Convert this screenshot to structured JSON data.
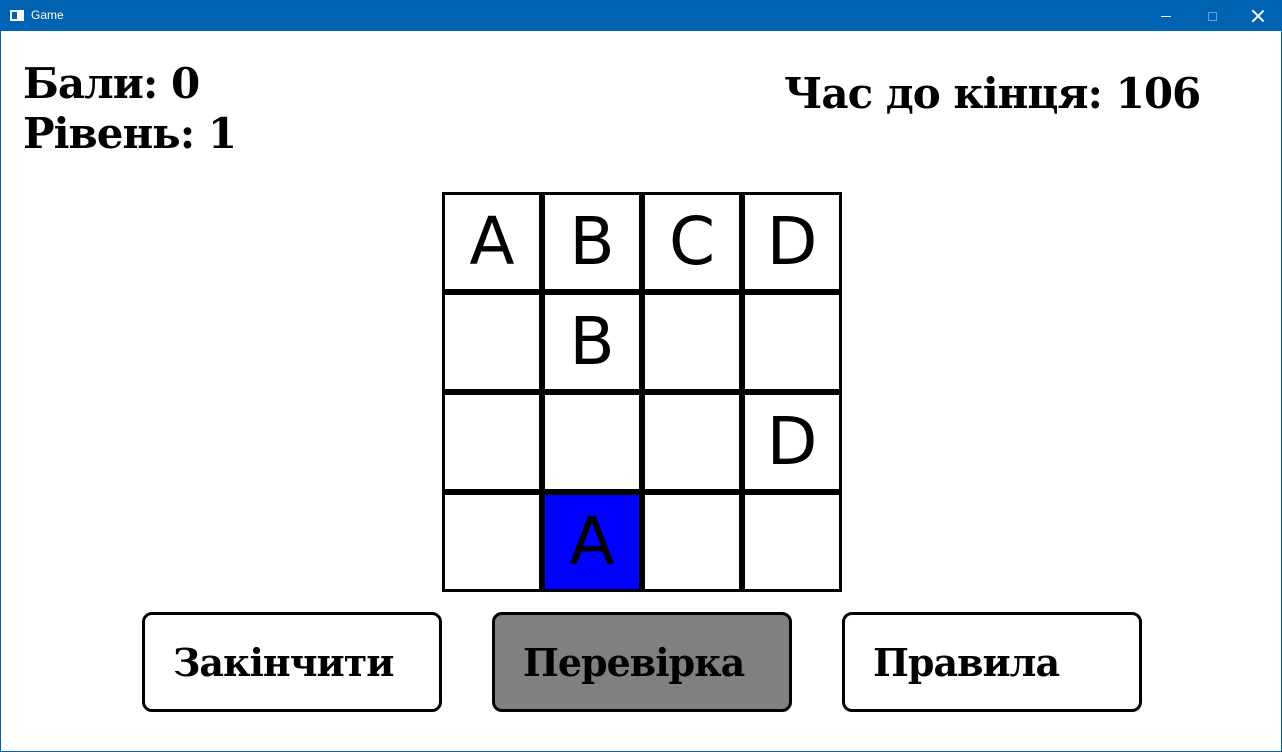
{
  "window": {
    "title": "Game",
    "accent_color": "#0063b1",
    "controls": [
      "minimize-icon",
      "maximize-icon",
      "close-icon"
    ]
  },
  "stats": {
    "score": "Бали: 0",
    "level": "Рівень: 1",
    "timer": "Час до кінця: 106"
  },
  "grid": {
    "rows": [
      [
        "A",
        "B",
        "C",
        "D"
      ],
      [
        "",
        "B",
        "",
        ""
      ],
      [
        "",
        "",
        "",
        "D"
      ],
      [
        "",
        "A",
        "",
        ""
      ]
    ],
    "selected": {
      "row": 3,
      "col": 1
    },
    "selected_color": "#0000ff"
  },
  "buttons": {
    "finish": "Закінчити",
    "check": "Перевірка",
    "rules": "Правила",
    "active_color": "#808080"
  }
}
